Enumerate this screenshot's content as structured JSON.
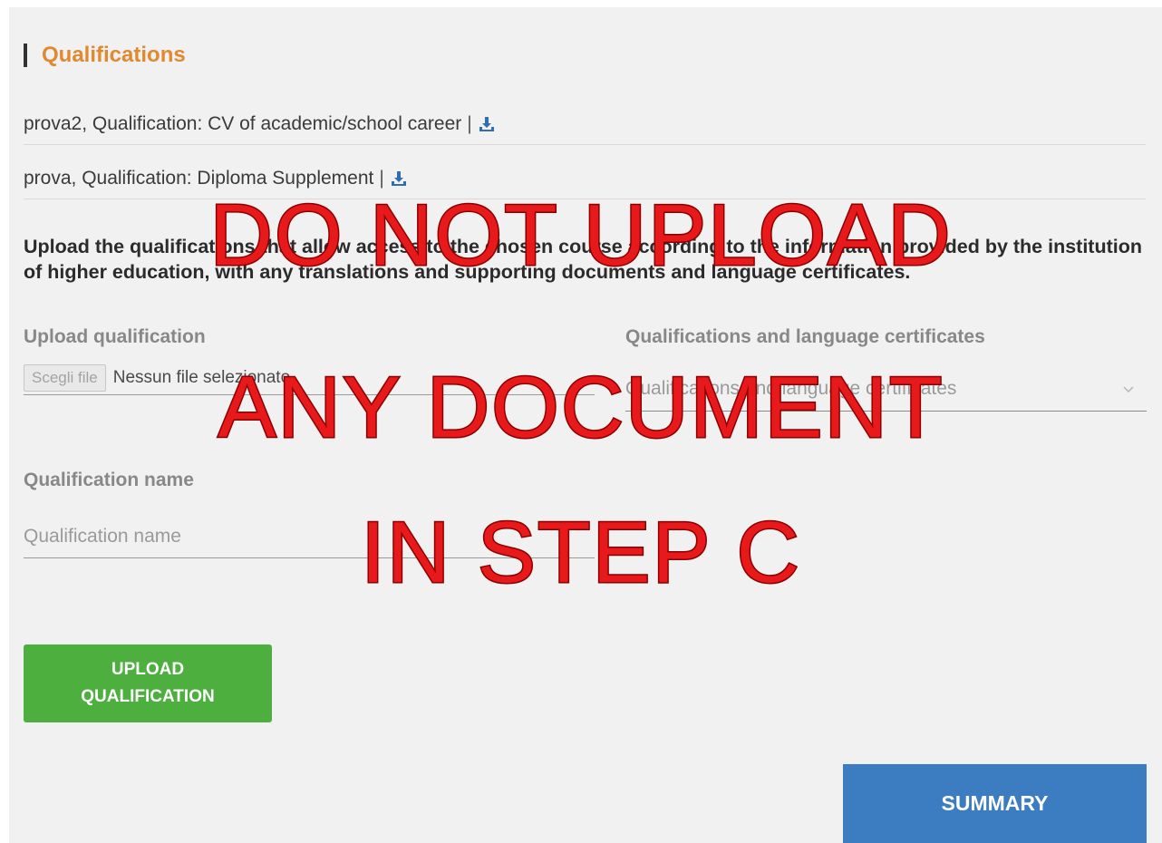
{
  "section": {
    "title": "Qualifications"
  },
  "existing_items": [
    {
      "text": "prova2, Qualification: CV of academic/school career",
      "separator": "|",
      "icon": "download-icon"
    },
    {
      "text": "prova, Qualification: Diploma Supplement",
      "separator": "|",
      "icon": "download-icon"
    }
  ],
  "instructions": "Upload the qualifications that allow access to the chosen course according to the information provided by the institution of higher education, with any translations and supporting documents and language certificates.",
  "upload": {
    "label": "Upload qualification",
    "file_button": "Scegli file",
    "file_status": "Nessun file selezionato"
  },
  "certificates": {
    "label": "Qualifications and language certificates",
    "placeholder": "Qualifications and language certificates",
    "icon": "chevron-down-icon"
  },
  "qualification_name": {
    "label": "Qualification name",
    "placeholder": "Qualification name"
  },
  "buttons": {
    "upload_line1": "UPLOAD",
    "upload_line2": "QUALIFICATION",
    "summary": "SUMMARY"
  },
  "overlay": {
    "line1": "DO NOT UPLOAD",
    "line2": "ANY DOCUMENT",
    "line3": "IN STEP C"
  },
  "colors": {
    "accent_title": "#e0892f",
    "upload_button": "#4caf3e",
    "summary_button": "#3c7cc0",
    "overlay_text": "#e8191b",
    "download_icon": "#2f6db5"
  }
}
